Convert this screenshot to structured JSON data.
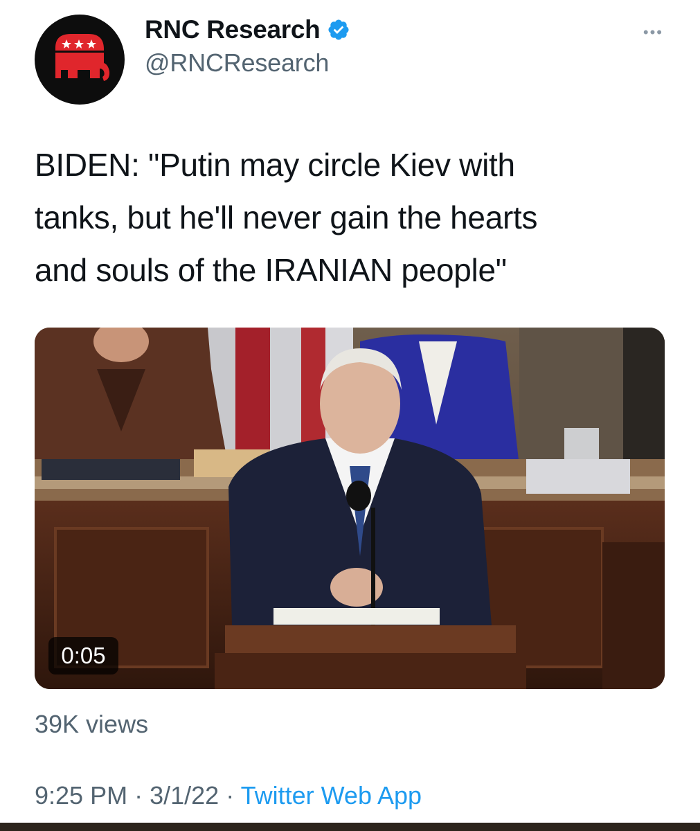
{
  "tweet": {
    "display_name": "RNC Research",
    "handle": "@RNCResearch",
    "verified": true,
    "more_icon": "more-horizontal-icon",
    "text_lines": [
      "BIDEN: \"Putin may circle Kiev with",
      "tanks, but he'll never gain the hearts",
      "and souls of the IRANIAN people\""
    ],
    "media": {
      "type": "video",
      "duration": "0:05"
    },
    "views": "39K views",
    "time": "9:25 PM",
    "date": "3/1/22",
    "separator": "·",
    "source_app": "Twitter Web App"
  },
  "colors": {
    "text_primary": "#0f1419",
    "text_secondary": "#536471",
    "link": "#1d9bf0",
    "verified_badge": "#1d9bf0",
    "avatar_bg": "#0d0d0d",
    "logo_red": "#e0262c"
  }
}
